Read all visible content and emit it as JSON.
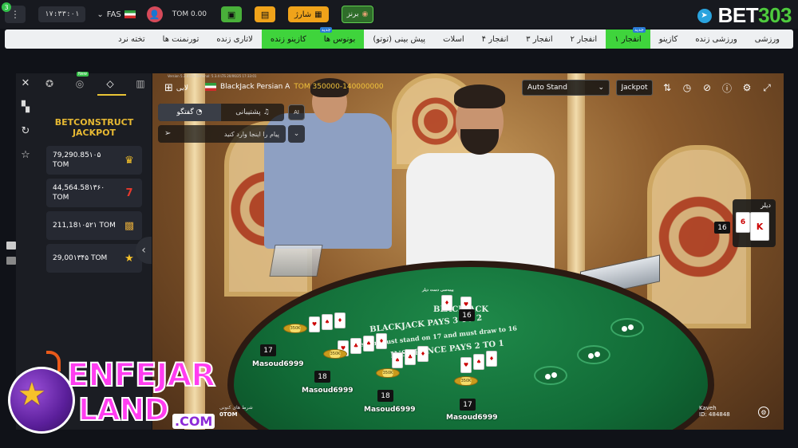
{
  "header": {
    "menu_badge": "3",
    "clock": "۱۷:۳۳:۰۱",
    "language": "FAS",
    "balance": "TOM 0.00",
    "charge_label": "شارژ",
    "bronze_label": "برنز",
    "logo_prefix": "BET",
    "logo_number": "303"
  },
  "nav": {
    "items": [
      {
        "label": "ورزشی",
        "highlight": false,
        "badge": ""
      },
      {
        "label": "ورزشی زنده",
        "highlight": false,
        "badge": ""
      },
      {
        "label": "کازینو",
        "highlight": false,
        "badge": ""
      },
      {
        "label": "انفجار ۱",
        "highlight": true,
        "badge": "جدید"
      },
      {
        "label": "انفجار ۲",
        "highlight": false,
        "badge": ""
      },
      {
        "label": "انفجار ۳",
        "highlight": false,
        "badge": ""
      },
      {
        "label": "انفجار ۴",
        "highlight": false,
        "badge": ""
      },
      {
        "label": "اسلات",
        "highlight": false,
        "badge": ""
      },
      {
        "label": "پیش بینی (توتو)",
        "highlight": false,
        "badge": ""
      },
      {
        "label": "بونوس ها",
        "highlight": true,
        "badge": "جدید"
      },
      {
        "label": "کازینو زنده",
        "highlight": true,
        "badge": ""
      },
      {
        "label": "لاتاری زنده",
        "highlight": false,
        "badge": ""
      },
      {
        "label": "تورنمنت ها",
        "highlight": false,
        "badge": ""
      },
      {
        "label": "تخته نرد",
        "highlight": false,
        "badge": ""
      }
    ]
  },
  "sidebar": {
    "new_badge": "New",
    "jackpot_title_line1": "BETCONSTRUCT",
    "jackpot_title_line2": "JACKPOT",
    "jackpots": [
      {
        "value": "79,290.85۱۰۵ TOM",
        "color": "#d3322c"
      },
      {
        "value": "44,564.58۱۳۶۰ TOM",
        "color": "#d3322c"
      },
      {
        "value": "211,18۱۰۵۲۱ TOM",
        "color": "#c9922a"
      },
      {
        "value": "29,00۱۳۴۵ TOM",
        "color": "#c62c2c"
      }
    ]
  },
  "game": {
    "meta_line": "Version 5.3.4 LTS   Terminal: 5.3.4 LTS   20/06/25 17:33:01",
    "lobby_label": "لابی",
    "title": "BlackJack Persian A",
    "limits": "TOM 350000-140000000",
    "chat_tab": "گفتگو",
    "support_tab": "پشتیبانی",
    "ai_label": "AI",
    "chat_placeholder": "پیام را اینجا وارد کنید",
    "autostand": "Auto Stand",
    "jackpot_btn": "Jackpot",
    "dealer_label": "دیلر",
    "dealer_score": "16",
    "dealer_cards": [
      "6",
      "K"
    ],
    "felt_title": "BLACKJACK",
    "felt_line1": "BLACKJACK PAYS 3 TO 2",
    "felt_line2": "Dealer must stand on 17 and must draw to 16",
    "felt_line3": "INSURANCE PAYS 2 TO 1",
    "felt_small": "بیمه‌سی دست دیلر",
    "center_score": "16",
    "players": [
      {
        "name": "Masoud6999",
        "score": "17"
      },
      {
        "name": "Masoud6999",
        "score": "18"
      },
      {
        "name": "Masoud6999",
        "score": "18"
      },
      {
        "name": "Masoud6999",
        "score": "17"
      }
    ],
    "total_bet_label": "شرط های کنونی",
    "total_bet_value": "0TOM",
    "user_name": "Kaveh",
    "user_id": "ID: 484848"
  },
  "watermark": {
    "line1": "ENFEJAR",
    "line2": "LAND",
    "suffix": ".COM"
  }
}
